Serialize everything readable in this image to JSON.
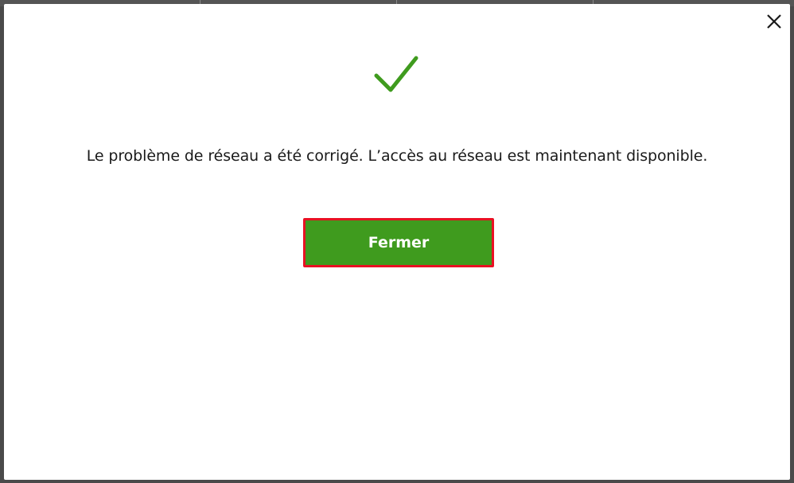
{
  "dialog": {
    "message": "Le problème de réseau a été corrigé. L’accès au réseau est maintenant disponible.",
    "primary_button_label": "Fermer",
    "status_icon": "checkmark-icon",
    "close_icon": "close-icon"
  },
  "colors": {
    "success_check": "#3f9b1e",
    "button_background": "#3f9b1e",
    "button_text": "#ffffff",
    "highlight_border": "#e81123"
  }
}
